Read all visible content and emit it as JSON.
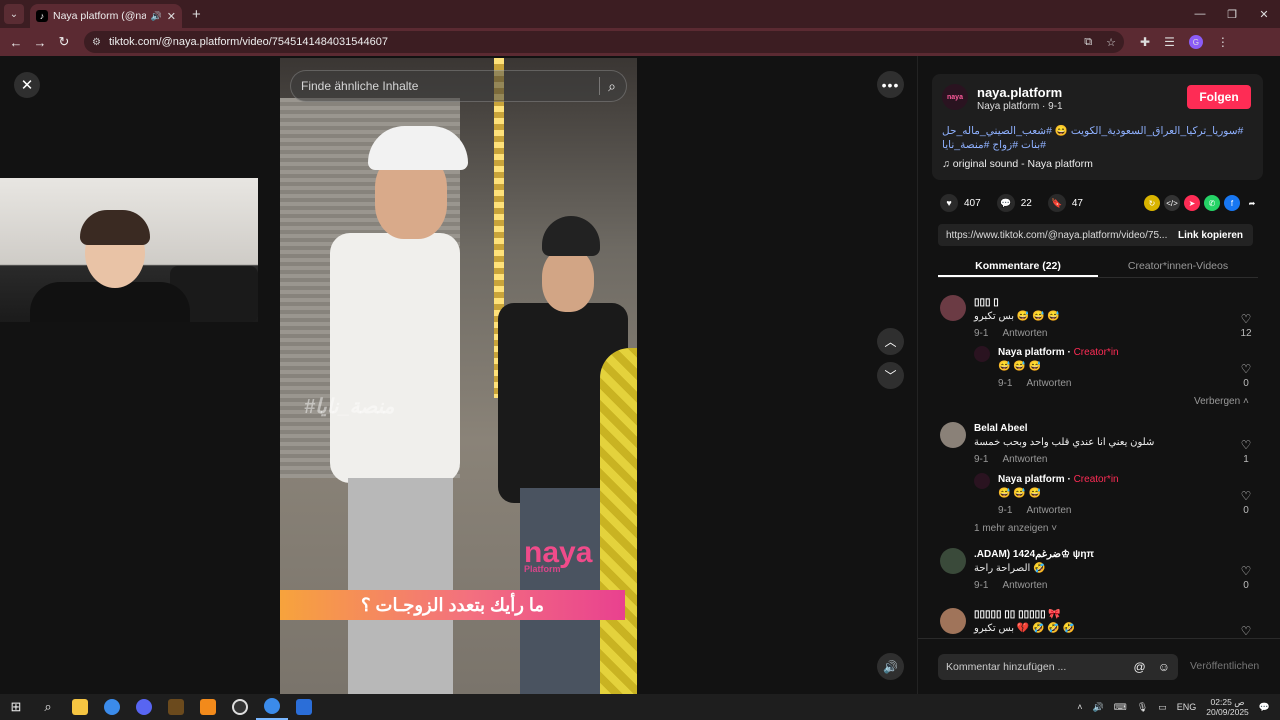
{
  "browser": {
    "tab_title": "Naya platform (@naya.platf...",
    "url": "tiktok.com/@naya.platform/video/7545141484031544607"
  },
  "player": {
    "search_placeholder": "Finde ähnliche Inhalte",
    "watermark": "#منصة_نايا",
    "logo_text": "naya",
    "logo_sub": "Platform",
    "banner_text": "ما رأيك بتعدد الزوجـات ؟"
  },
  "post": {
    "username": "naya.platform",
    "subline": "Naya platform · 9-1",
    "follow_label": "Folgen",
    "caption": "#سوريا_تركيا_العراق_السعودية_الكويت 😄 #شعب_الصيني_ماله_حل #بنات #زواج #منصة_نايا",
    "sound": "original sound - Naya platform",
    "likes": "407",
    "comments": "22",
    "saves": "47",
    "link": "https://www.tiktok.com/@naya.platform/video/75...",
    "copy_label": "Link kopieren",
    "tab_comments": "Kommentare (22)",
    "tab_creator": "Creator*innen-Videos"
  },
  "comments": [
    {
      "name": "▯▯▯ ▯",
      "text": "بس تكبرو 😅 😅 😅",
      "date": "9-1",
      "reply": "Antworten",
      "likes": "12"
    },
    {
      "name": "Naya platform",
      "tag": "Creator*in",
      "text": "😅 😅 😅",
      "date": "9-1",
      "reply": "Antworten",
      "likes": "0"
    },
    {
      "name": "Belal Abeel",
      "text": "شلون يعني انا عندي قلب واحد وبحب خمسة",
      "date": "9-1",
      "reply": "Antworten",
      "likes": "1"
    },
    {
      "name": "Naya platform",
      "tag": "Creator*in",
      "text": "😅 😅 😅",
      "date": "9-1",
      "reply": "Antworten",
      "likes": "0"
    },
    {
      "name": ".ADAM) ضرغم1424♔ ψηπ",
      "text": "الصراحة راحة 🤣",
      "date": "9-1",
      "reply": "Antworten",
      "likes": "0"
    },
    {
      "name": "▯▯▯▯▯ ▯▯ ▯▯▯▯▯ 🎀",
      "text": "بس تكبرو 💔 🤣 🤣 🤣",
      "date": "",
      "reply": "",
      "likes": ""
    }
  ],
  "toggles": {
    "hide": "Verbergen",
    "show_more": "1 mehr anzeigen"
  },
  "composer": {
    "placeholder": "Kommentar hinzufügen ...",
    "post_label": "Veröffentlichen"
  },
  "taskbar": {
    "lang": "ENG",
    "time": "02:25 ص",
    "date": "20/09/2025"
  }
}
